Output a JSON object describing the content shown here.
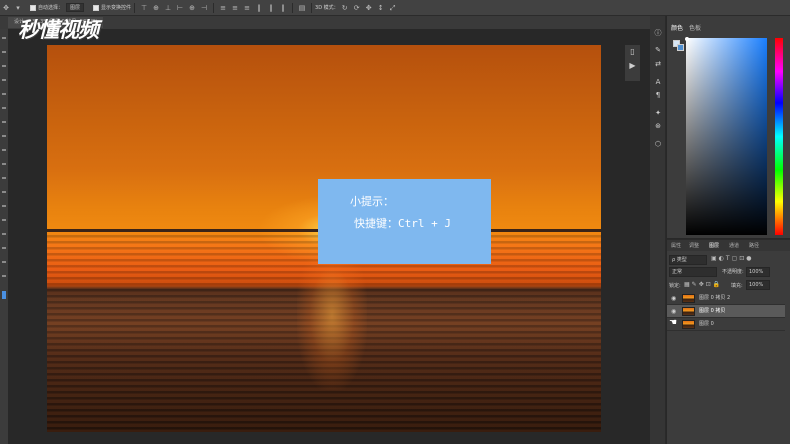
{
  "options_bar": {
    "auto_select_label": "自动选择：",
    "auto_select_value": "图层",
    "show_transform_label": "显示变换控件",
    "mode_3d_label": "3D 模式："
  },
  "document": {
    "tab_label": "设计 @ 33.3%(图层 0 拷贝, RGB/8)"
  },
  "logo": {
    "text": "秒懂视频"
  },
  "tip": {
    "title": "小提示：",
    "shortcut": "快捷键：Ctrl + J"
  },
  "color_panel": {
    "tabs": [
      "颜色",
      "色板"
    ],
    "foreground": "#d7e6f6",
    "background": "#4f8fd0"
  },
  "layers_panel": {
    "tabs": [
      "属性",
      "调整",
      "图层",
      "通道",
      "路径"
    ],
    "active_tab": "图层",
    "filter_label": "ρ 类型",
    "blend_mode": "正常",
    "opacity_label": "不透明度:",
    "opacity_value": "100%",
    "lock_label": "锁定:",
    "fill_label": "填充:",
    "fill_value": "100%",
    "layers": [
      {
        "name": "图层 0 拷贝 2",
        "visible": true,
        "selected": false
      },
      {
        "name": "图层 0 拷贝",
        "visible": true,
        "selected": true
      },
      {
        "name": "图层 0",
        "visible": false,
        "selected": false
      }
    ]
  },
  "icons": {
    "move_tool": "move-icon",
    "info": "info-icon",
    "brush": "brush-icon",
    "char": "character-icon",
    "para": "paragraph-icon",
    "layer3d": "3d-icon"
  }
}
